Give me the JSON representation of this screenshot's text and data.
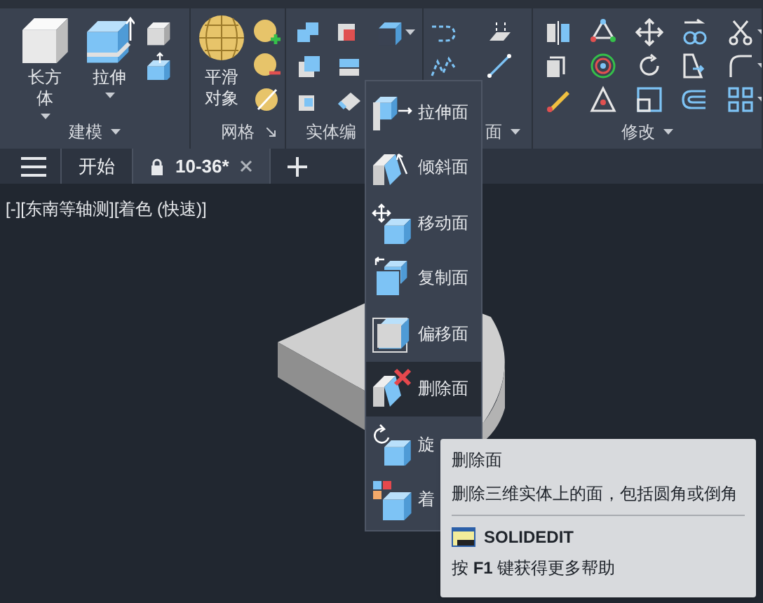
{
  "ribbon": {
    "panels": [
      {
        "kind": "model",
        "label": "建模",
        "menu": true,
        "buttons": [
          {
            "label": "长方体",
            "dropdown": true
          },
          {
            "label": "拉伸",
            "dropdown": true
          }
        ]
      },
      {
        "kind": "mesh",
        "label": "网格",
        "launcher": true,
        "buttons": [
          {
            "label": "平滑对象",
            "dropdown": false
          }
        ]
      },
      {
        "kind": "solid",
        "label": "实体编",
        "menu": false
      },
      {
        "kind": "surface",
        "label": "面",
        "menu": true
      },
      {
        "kind": "modify",
        "label": "修改",
        "menu": true
      }
    ]
  },
  "tabs": [
    {
      "label": "开始",
      "selected": false,
      "locked": false,
      "closable": false
    },
    {
      "label": "10-36*",
      "selected": true,
      "locked": true,
      "closable": true
    }
  ],
  "viewport": {
    "label": "[-][东南等轴测][着色 (快速)]"
  },
  "flyout": {
    "items": [
      {
        "label": "拉伸面",
        "selected": false
      },
      {
        "label": "倾斜面",
        "selected": false
      },
      {
        "label": "移动面",
        "selected": false
      },
      {
        "label": "复制面",
        "selected": false
      },
      {
        "label": "偏移面",
        "selected": false
      },
      {
        "label": "删除面",
        "selected": true
      },
      {
        "label": "旋",
        "selected": false
      },
      {
        "label": "着",
        "selected": false
      }
    ]
  },
  "tooltip": {
    "title": "删除面",
    "description": "删除三维实体上的面，包括圆角或倒角",
    "command": "SOLIDEDIT",
    "help": "按 **F1** 键获得更多帮助"
  }
}
